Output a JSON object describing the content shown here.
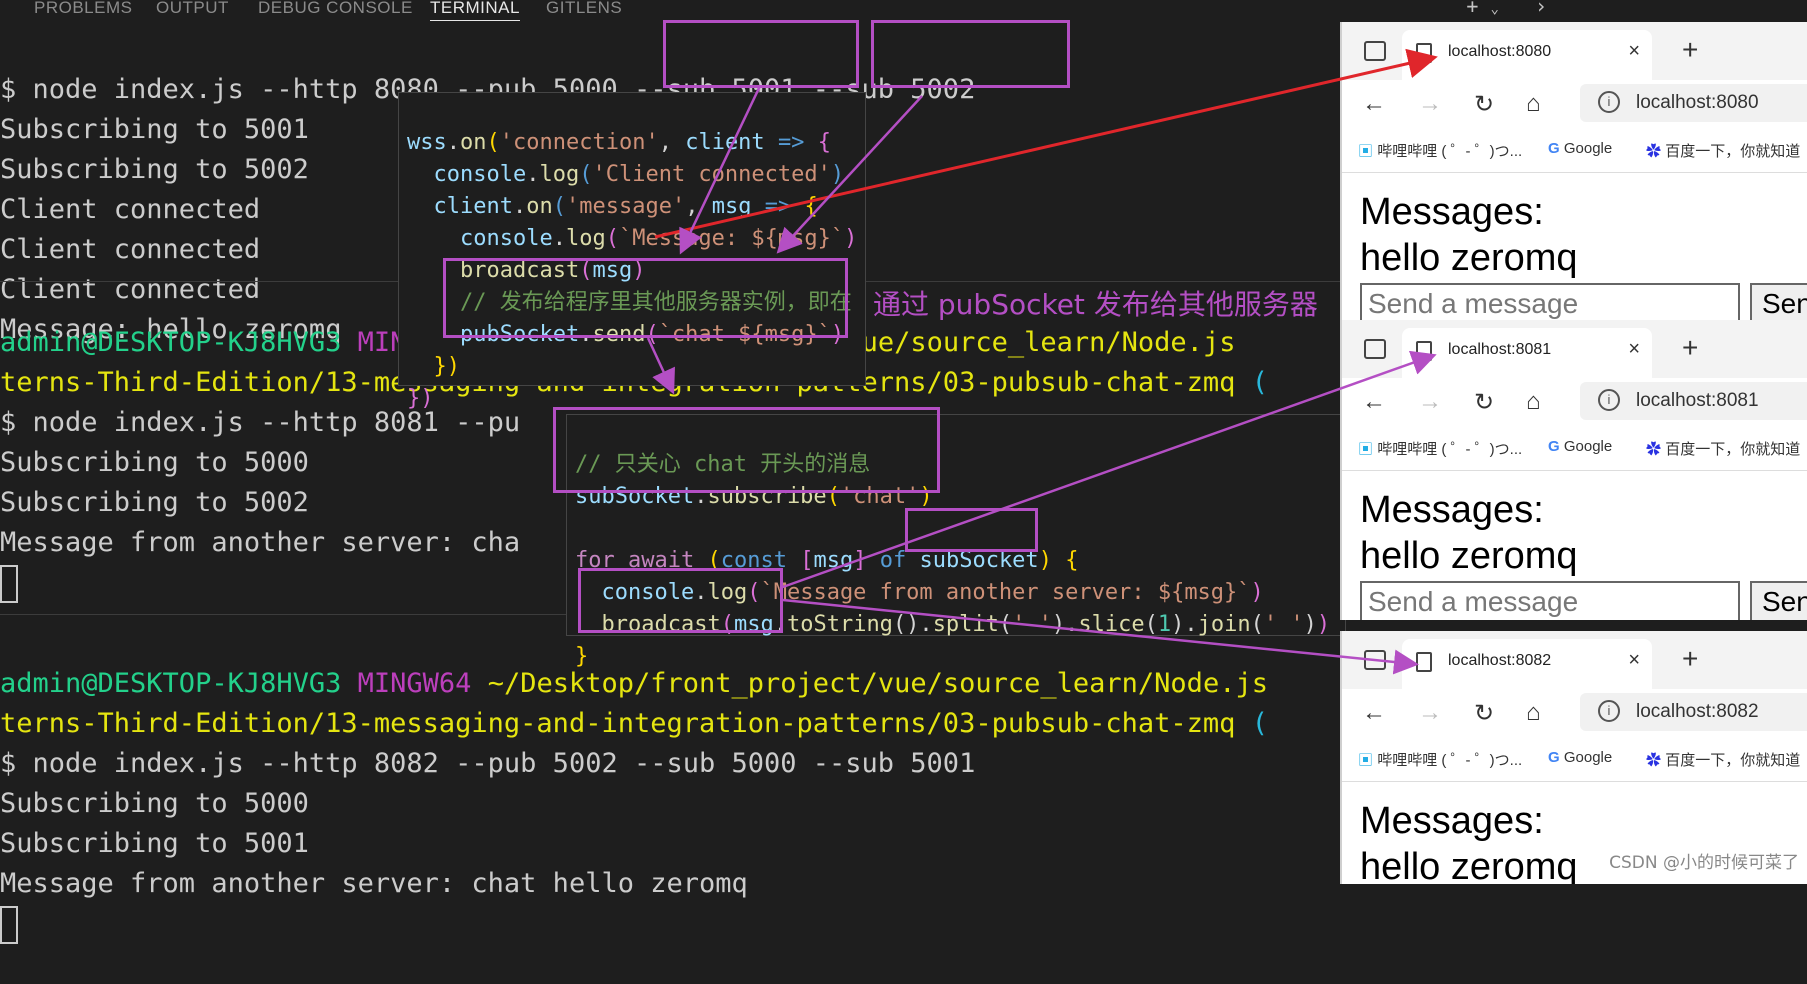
{
  "panel_tabs": [
    "PROBLEMS",
    "OUTPUT",
    "DEBUG CONSOLE",
    "TERMINAL",
    "GITLENS"
  ],
  "terminal1": {
    "cmd": "$ node index.js --http 8080 --pub 5000 --sub 5001 --sub 5002",
    "lines": [
      "Subscribing to 5001",
      "Subscribing to 5002",
      "Client connected",
      "Client connected",
      "Client connected",
      "Message: hello zeromq"
    ]
  },
  "terminal2": {
    "user": "admin@DESKTOP-KJ8HVG3",
    "shell": "MINGW64",
    "path_end": "ject/vue/source_learn/Node.js",
    "path2": "terns-Third-Edition/13-messaging-and-integration-patterns/03-pubsub-chat-zmq",
    "paren": "(",
    "cmd": "$ node index.js --http 8081 --pu",
    "lines": [
      "Subscribing to 5000",
      "Subscribing to 5002",
      "Message from another server: cha"
    ]
  },
  "terminal3": {
    "user": "admin@DESKTOP-KJ8HVG3",
    "shell": "MINGW64",
    "path": "~/Desktop/front_project/vue/source_learn/Node.js",
    "path2": "terns-Third-Edition/13-messaging-and-integration-patterns/03-pubsub-chat-zmq",
    "paren": "(",
    "cmd": "$ node index.js --http 8082 --pub 5002 --sub 5000 --sub 5001",
    "lines": [
      "Subscribing to 5000",
      "Subscribing to 5001",
      "Message from another server: chat hello zeromq"
    ]
  },
  "annotation": "通过 pubSocket 发布给其他服务器",
  "code1": {
    "wss": "wss",
    "on": "on",
    "connection": "'connection'",
    "client": "client",
    "console": "console",
    "log": "log",
    "client_connected": "'Client connected'",
    "message": "'message'",
    "msg": "msg",
    "message_tpl": "`Message: ${msg}`",
    "broadcast": "broadcast",
    "comment": "// 发布给程序里其他服务器实例，即在",
    "pubSocket": "pubSocket",
    "send": "send",
    "chat_tpl": "`chat ${msg}`"
  },
  "code2": {
    "comment": "// 只关心 chat 开头的消息",
    "subSocket": "subSocket",
    "subscribe": "subscribe",
    "chat": "'chat'",
    "for": "for",
    "await": "await",
    "const": "const",
    "msg": "msg",
    "of": "of",
    "console": "console",
    "log": "log",
    "tpl": "`Message from another server: ${msg}`",
    "broadcast": "broadcast",
    "toString": "toString",
    "split": "split",
    "space": "' '",
    "slice": "slice",
    "one": "1",
    "join": "join"
  },
  "browsers": [
    {
      "tab": "localhost:8080",
      "url": "localhost:8080"
    },
    {
      "tab": "localhost:8081",
      "url": "localhost:8081"
    },
    {
      "tab": "localhost:8082",
      "url": "localhost:8082"
    }
  ],
  "bookmarks": {
    "bili": "哔哩哔哩 ( ゜- ゜)つ...",
    "google": "Google",
    "baidu": "百度一下，你就知道"
  },
  "page": {
    "heading": "Messages:",
    "message": "hello zeromq",
    "placeholder": "Send a message",
    "send": "Send"
  },
  "watermark": "CSDN @小的时候可菜了",
  "colors": {
    "highlight": "#b44fc4",
    "red_arrow": "#e0262b",
    "terminal_bg": "#1e1e1e"
  }
}
